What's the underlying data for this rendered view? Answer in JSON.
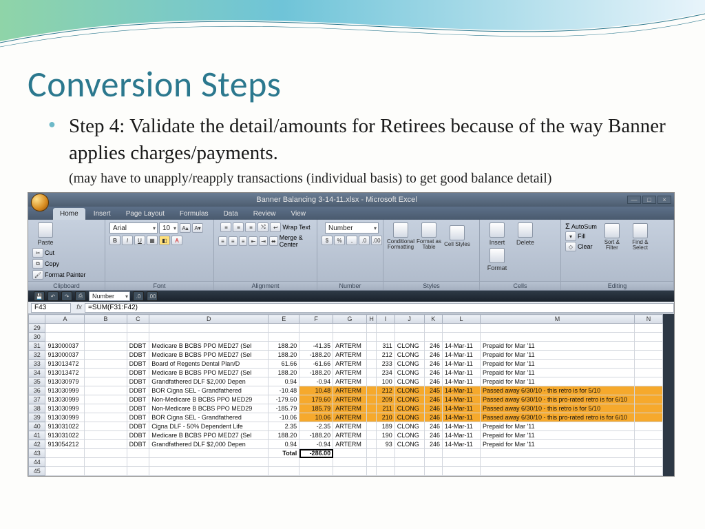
{
  "slide": {
    "title": "Conversion Steps",
    "bullet": "Step 4: Validate the detail/amounts for Retirees because of the way Banner applies charges/payments.",
    "subnote": "(may have to unapply/reapply transactions (individual basis) to get good balance detail)"
  },
  "excel": {
    "titlebar": "Banner Balancing 3-14-11.xlsx - Microsoft Excel",
    "tabs": [
      "Home",
      "Insert",
      "Page Layout",
      "Formulas",
      "Data",
      "Review",
      "View"
    ],
    "active_tab": 0,
    "ribbon_groups": {
      "clipboard": {
        "label": "Clipboard",
        "paste": "Paste",
        "cut": "Cut",
        "copy": "Copy",
        "fp": "Format Painter"
      },
      "font": {
        "label": "Font",
        "name": "Arial",
        "size": "10"
      },
      "alignment": {
        "label": "Alignment",
        "wrap": "Wrap Text",
        "merge": "Merge & Center"
      },
      "number": {
        "label": "Number",
        "format": "Number"
      },
      "styles": {
        "label": "Styles",
        "cf": "Conditional Formatting",
        "ft": "Format as Table",
        "cs": "Cell Styles"
      },
      "cells": {
        "label": "Cells",
        "ins": "Insert",
        "del": "Delete",
        "fmt": "Format"
      },
      "editing": {
        "label": "Editing",
        "sum": "AutoSum",
        "fill": "Fill",
        "clear": "Clear",
        "sort": "Sort & Filter",
        "find": "Find & Select"
      }
    },
    "qat_number": "Number",
    "namebox": "F43",
    "formula": "=SUM(F31:F42)",
    "columns": [
      "",
      "A",
      "B",
      "C",
      "D",
      "E",
      "F",
      "G",
      "H",
      "I",
      "J",
      "K",
      "L",
      "M",
      "N"
    ],
    "row_start": 29,
    "selected_col": "F",
    "rows": [
      {
        "r": 29
      },
      {
        "r": 30
      },
      {
        "r": 31,
        "a": "913000037",
        "c": "DDBT",
        "d": "Medicare B BCBS PPO MED27 (Sel",
        "e": "188.20",
        "f": "-41.35",
        "g": "ARTERM",
        "i": "311",
        "j": "CLONG",
        "k": "246",
        "l": "14-Mar-11",
        "m": "Prepaid for Mar '11"
      },
      {
        "r": 32,
        "a": "913000037",
        "c": "DDBT",
        "d": "Medicare B BCBS PPO MED27 (Sel",
        "e": "188.20",
        "f": "-188.20",
        "g": "ARTERM",
        "i": "212",
        "j": "CLONG",
        "k": "246",
        "l": "14-Mar-11",
        "m": "Prepaid for Mar '11"
      },
      {
        "r": 33,
        "a": "913013472",
        "c": "DDBT",
        "d": "Board of Regents Dental Plan/D",
        "e": "61.66",
        "f": "-61.66",
        "g": "ARTERM",
        "i": "233",
        "j": "CLONG",
        "k": "246",
        "l": "14-Mar-11",
        "m": "Prepaid for Mar '11"
      },
      {
        "r": 34,
        "a": "913013472",
        "c": "DDBT",
        "d": "Medicare B BCBS PPO MED27 (Sel",
        "e": "188.20",
        "f": "-188.20",
        "g": "ARTERM",
        "i": "234",
        "j": "CLONG",
        "k": "246",
        "l": "14-Mar-11",
        "m": "Prepaid for Mar '11"
      },
      {
        "r": 35,
        "a": "913030979",
        "c": "DDBT",
        "d": "Grandfathered DLF $2,000 Depen",
        "e": "0.94",
        "f": "-0.94",
        "g": "ARTERM",
        "i": "100",
        "j": "CLONG",
        "k": "246",
        "l": "14-Mar-11",
        "m": "Prepaid for Mar '11"
      },
      {
        "r": 36,
        "hl": true,
        "a": "913030999",
        "c": "DDBT",
        "d": "BOR Cigna SEL - Grandfathered",
        "e": "-10.48",
        "f": "10.48",
        "g": "ARTERM",
        "i": "212",
        "j": "CLONG",
        "k": "245",
        "l": "14-Mar-11",
        "m": "Passed away 6/30/10 - this retro is for 5/10"
      },
      {
        "r": 37,
        "hl": true,
        "a": "913030999",
        "c": "DDBT",
        "d": "Non-Medicare B BCBS PPO MED29",
        "e": "-179.60",
        "f": "179.60",
        "g": "ARTERM",
        "i": "209",
        "j": "CLONG",
        "k": "246",
        "l": "14-Mar-11",
        "m": "Passed away 6/30/10 - this pro-rated retro is for 6/10"
      },
      {
        "r": 38,
        "hl": true,
        "a": "913030999",
        "c": "DDBT",
        "d": "Non-Medicare B BCBS PPO MED29",
        "e": "-185.79",
        "f": "185.79",
        "g": "ARTERM",
        "i": "211",
        "j": "CLONG",
        "k": "246",
        "l": "14-Mar-11",
        "m": "Passed away 6/30/10 - this retro is for 5/10"
      },
      {
        "r": 39,
        "hl": true,
        "a": "913030999",
        "c": "DDBT",
        "d": "BOR Cigna SEL - Grandfathered",
        "e": "-10.06",
        "f": "10.06",
        "g": "ARTERM",
        "i": "210",
        "j": "CLONG",
        "k": "246",
        "l": "14-Mar-11",
        "m": "Passed away 6/30/10 - this pro-rated retro is for 6/10"
      },
      {
        "r": 40,
        "a": "913031022",
        "c": "DDBT",
        "d": "Cigna DLF - 50% Dependent Life",
        "e": "2.35",
        "f": "-2.35",
        "g": "ARTERM",
        "i": "189",
        "j": "CLONG",
        "k": "246",
        "l": "14-Mar-11",
        "m": "Prepaid for Mar '11"
      },
      {
        "r": 41,
        "a": "913031022",
        "c": "DDBT",
        "d": "Medicare B BCBS PPO MED27 (Sel",
        "e": "188.20",
        "f": "-188.20",
        "g": "ARTERM",
        "i": "190",
        "j": "CLONG",
        "k": "246",
        "l": "14-Mar-11",
        "m": "Prepaid for Mar '11"
      },
      {
        "r": 42,
        "a": "913054212",
        "c": "DDBT",
        "d": "Grandfathered DLF $2,000 Depen",
        "e": "0.94",
        "f": "-0.94",
        "g": "ARTERM",
        "i": "93",
        "j": "CLONG",
        "k": "246",
        "l": "14-Mar-11",
        "m": "Prepaid for Mar '11"
      },
      {
        "r": 43,
        "total": true,
        "e": "Total",
        "f": "-286.00"
      },
      {
        "r": 44
      },
      {
        "r": 45
      }
    ]
  }
}
